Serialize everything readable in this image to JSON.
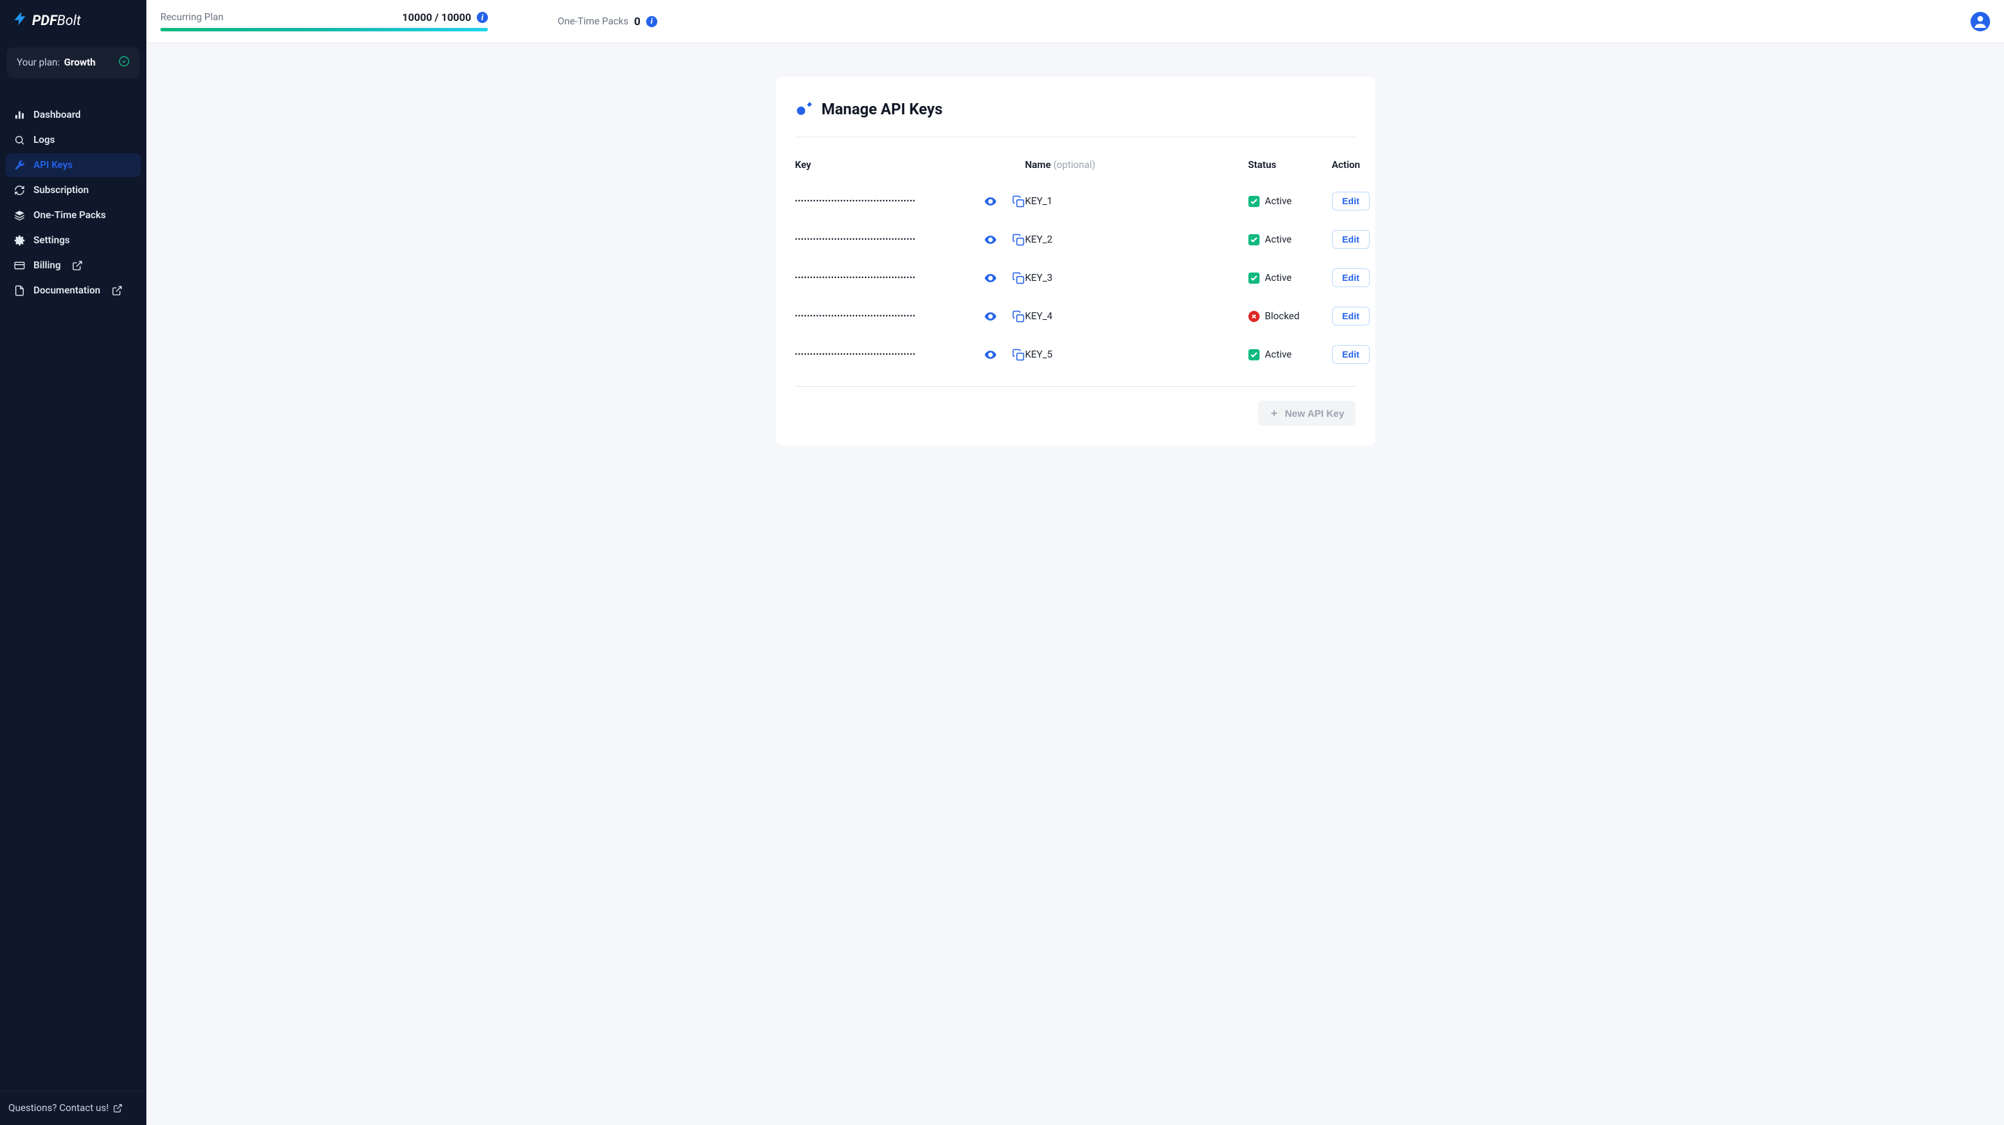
{
  "brand": {
    "name_a": "PDF",
    "name_b": "Bolt"
  },
  "sidebar": {
    "plan_label": "Your plan:",
    "plan_name": "Growth",
    "items": [
      {
        "id": "dashboard",
        "label": "Dashboard"
      },
      {
        "id": "logs",
        "label": "Logs"
      },
      {
        "id": "apikeys",
        "label": "API Keys"
      },
      {
        "id": "subscription",
        "label": "Subscription"
      },
      {
        "id": "packs",
        "label": "One-Time Packs"
      },
      {
        "id": "settings",
        "label": "Settings"
      },
      {
        "id": "billing",
        "label": "Billing"
      },
      {
        "id": "docs",
        "label": "Documentation"
      }
    ],
    "footer": "Questions? Contact us!"
  },
  "topbar": {
    "recurring_label": "Recurring Plan",
    "recurring_value": "10000 / 10000",
    "onetime_label": "One-Time Packs",
    "onetime_count": "0"
  },
  "page": {
    "title": "Manage API Keys",
    "columns": {
      "key": "Key",
      "name": "Name",
      "name_optional": "(optional)",
      "status": "Status",
      "action": "Action"
    },
    "mask": "••••••••••••••••••••••••••••••••••••••••",
    "status_active": "Active",
    "status_blocked": "Blocked",
    "edit": "Edit",
    "new_key": "New API Key",
    "rows": [
      {
        "name": "KEY_1",
        "status": "active"
      },
      {
        "name": "KEY_2",
        "status": "active"
      },
      {
        "name": "KEY_3",
        "status": "active"
      },
      {
        "name": "KEY_4",
        "status": "blocked"
      },
      {
        "name": "KEY_5",
        "status": "active"
      }
    ]
  }
}
